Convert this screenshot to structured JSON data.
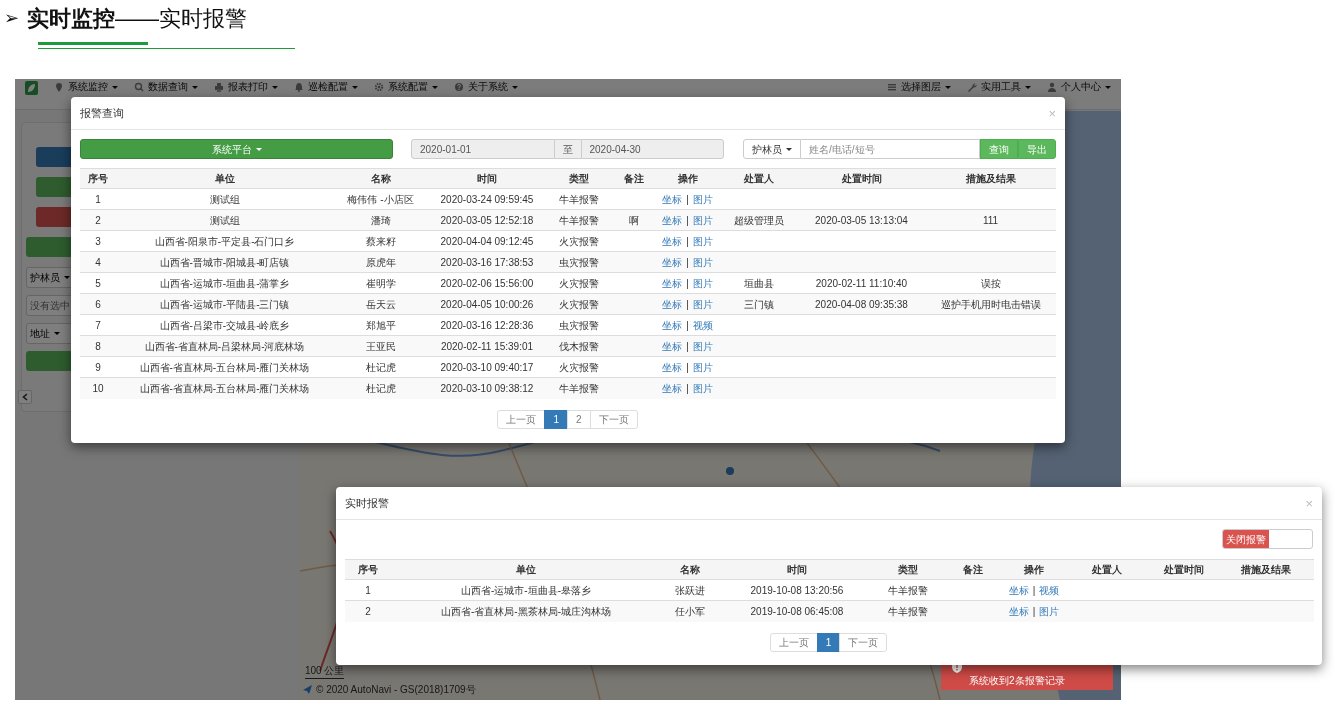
{
  "slide": {
    "marker": "➢",
    "title": "**实时监控**——实时报警"
  },
  "app": {
    "navbar": {
      "left": [
        "系统监控",
        "数据查询",
        "报表打印",
        "巡检配置",
        "系统配置",
        "关于系统"
      ],
      "right": [
        "选择图层",
        "实用工具",
        "个人中心"
      ]
    },
    "sidebar": {
      "fields": [
        {
          "kind": "dropdown",
          "label": "护林员"
        },
        {
          "kind": "input",
          "placeholder": "没有选中"
        },
        {
          "kind": "dropdown",
          "label": "地址"
        }
      ]
    },
    "map": {
      "scale": "100 公里",
      "attribution": "© 2020 AutoNavi - GS(2018)1709号"
    }
  },
  "query_dialog": {
    "title": "报警查询",
    "close": "×",
    "platform_button": "系统平台",
    "date_from": "2020-01-01",
    "date_sep": "至",
    "date_to": "2020-04-30",
    "search_type": "护林员",
    "search_placeholder": "姓名/电话/短号",
    "buttons": [
      "查询",
      "导出"
    ],
    "columns": [
      "序号",
      "单位",
      "名称",
      "时间",
      "类型",
      "备注",
      "操作",
      "处置人",
      "处置时间",
      "措施及结果"
    ],
    "action_separator": "|",
    "rows": [
      {
        "no": "1",
        "unit": "测试组",
        "name": "梅伟伟 -小店区",
        "time": "2020-03-24 09:59:45",
        "type": "牛羊报警",
        "actions": [
          "坐标",
          "图片"
        ]
      },
      {
        "no": "2",
        "unit": "测试组",
        "name": "潘琦",
        "time": "2020-03-05 12:52:18",
        "type": "牛羊报警",
        "note": "啊",
        "actions": [
          "坐标",
          "图片"
        ],
        "handler": "超级管理员",
        "handle_time": "2020-03-05 13:13:04",
        "result": "111"
      },
      {
        "no": "3",
        "unit": "山西省-阳泉市-平定县-石门口乡",
        "name": "蔡来籽",
        "time": "2020-04-04 09:12:45",
        "type": "火灾报警",
        "actions": [
          "坐标",
          "图片"
        ]
      },
      {
        "no": "4",
        "unit": "山西省-晋城市-阳城县-町店镇",
        "name": "原虎年",
        "time": "2020-03-16 17:38:53",
        "type": "虫灾报警",
        "actions": [
          "坐标",
          "图片"
        ]
      },
      {
        "no": "5",
        "unit": "山西省-运城市-垣曲县-蒲掌乡",
        "name": "崔明学",
        "time": "2020-02-06 15:56:00",
        "type": "火灾报警",
        "actions": [
          "坐标",
          "图片"
        ],
        "handler": "垣曲县",
        "handle_time": "2020-02-11 11:10:40",
        "result": "误按"
      },
      {
        "no": "6",
        "unit": "山西省-运城市-平陆县-三门镇",
        "name": "岳天云",
        "time": "2020-04-05 10:00:26",
        "type": "火灾报警",
        "actions": [
          "坐标",
          "图片"
        ],
        "handler": "三门镇",
        "handle_time": "2020-04-08 09:35:38",
        "result": "巡护手机用时电击错误"
      },
      {
        "no": "7",
        "unit": "山西省-吕梁市-交城县-岭底乡",
        "name": "郑旭平",
        "time": "2020-03-16 12:28:36",
        "type": "虫灾报警",
        "actions": [
          "坐标",
          "视频"
        ]
      },
      {
        "no": "8",
        "unit": "山西省-省直林局-吕梁林局-河底林场",
        "name": "王亚民",
        "time": "2020-02-11 15:39:01",
        "type": "伐木报警",
        "actions": [
          "坐标",
          "图片"
        ]
      },
      {
        "no": "9",
        "unit": "山西省-省直林局-五台林局-雁门关林场",
        "name": "杜记虎",
        "time": "2020-03-10 09:40:17",
        "type": "火灾报警",
        "actions": [
          "坐标",
          "图片"
        ]
      },
      {
        "no": "10",
        "unit": "山西省-省直林局-五台林局-雁门关林场",
        "name": "杜记虎",
        "time": "2020-03-10 09:38:12",
        "type": "牛羊报警",
        "actions": [
          "坐标",
          "图片"
        ]
      }
    ],
    "pagination": [
      {
        "label": "上一页",
        "selected": false
      },
      {
        "label": "1",
        "selected": true
      },
      {
        "label": "2",
        "selected": false
      },
      {
        "label": "下一页",
        "selected": false
      }
    ]
  },
  "alarm_dialog": {
    "title": "实时报警",
    "close": "×",
    "alarm_switch": {
      "label": "关闭报警",
      "on": true
    },
    "columns": [
      "序号",
      "单位",
      "名称",
      "时间",
      "类型",
      "备注",
      "操作",
      "处置人",
      "处置时间",
      "措施及结果"
    ],
    "action_separator": "|",
    "rows": [
      {
        "no": "1",
        "unit": "山西省-运城市-垣曲县-皋落乡",
        "name": "张跃进",
        "time": "2019-10-08 13:20:56",
        "type": "牛羊报警",
        "actions": [
          "坐标",
          "视频"
        ]
      },
      {
        "no": "2",
        "unit": "山西省-省直林局-黑茶林局-城庄沟林场",
        "name": "任小军",
        "time": "2019-10-08 06:45:08",
        "type": "牛羊报警",
        "actions": [
          "坐标",
          "图片"
        ]
      }
    ],
    "pagination": [
      {
        "label": "上一页",
        "selected": false
      },
      {
        "label": "1",
        "selected": true
      },
      {
        "label": "下一页",
        "selected": false
      }
    ]
  },
  "toast": {
    "message": "系统收到2条报警记录"
  }
}
